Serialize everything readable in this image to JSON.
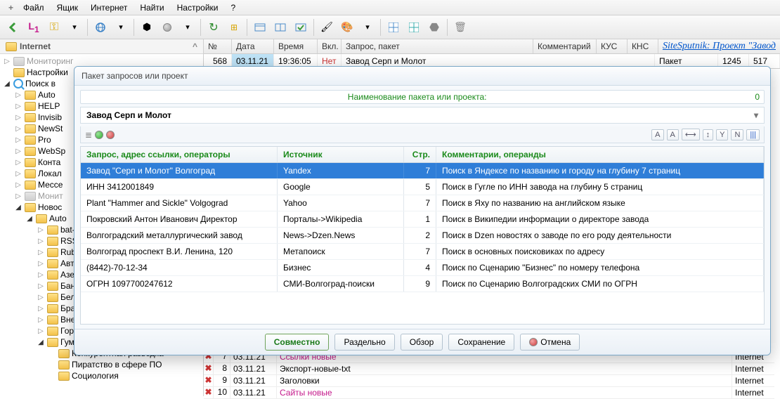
{
  "menu": {
    "plus": "+",
    "items": [
      "Файл",
      "Ящик",
      "Интернет",
      "Найти",
      "Настройки",
      "?"
    ]
  },
  "toolbar_icons": [
    "back-arrow",
    "l1",
    "keys",
    "v",
    "globe",
    "v",
    "cubes",
    "sphere",
    "v",
    "refresh",
    "tree-icon",
    "window",
    "window-h",
    "window-check",
    "brush",
    "palette",
    "v",
    "grid-blue",
    "grid-teal",
    "hexagon",
    "trash"
  ],
  "tree": {
    "header": "Internet",
    "nodes": [
      {
        "arrow": "▷",
        "cls": "gray indent-0",
        "label": "Мониторинг"
      },
      {
        "arrow": "",
        "cls": "indent-0",
        "label": "Настройки"
      },
      {
        "arrow": "◢",
        "cls": "indent-0 open",
        "icon": "mag",
        "label": "Поиск в"
      },
      {
        "arrow": "▷",
        "cls": "indent-1",
        "label": "Auto"
      },
      {
        "arrow": "▷",
        "cls": "indent-1",
        "label": "HELP"
      },
      {
        "arrow": "▷",
        "cls": "indent-1",
        "label": "Invisib"
      },
      {
        "arrow": "▷",
        "cls": "indent-1",
        "label": "NewSt"
      },
      {
        "arrow": "▷",
        "cls": "indent-1",
        "label": "Pro"
      },
      {
        "arrow": "▷",
        "cls": "indent-1",
        "label": "WebSp"
      },
      {
        "arrow": "▷",
        "cls": "indent-1",
        "label": "Конта"
      },
      {
        "arrow": "▷",
        "cls": "indent-1",
        "label": "Локал"
      },
      {
        "arrow": "▷",
        "cls": "indent-1",
        "label": "Мессе"
      },
      {
        "arrow": "▷",
        "cls": "gray indent-1",
        "label": "Монит"
      },
      {
        "arrow": "◢",
        "cls": "indent-1 open",
        "label": "Новос"
      },
      {
        "arrow": "◢",
        "cls": "indent-2 open",
        "label": "Auto"
      },
      {
        "arrow": "▷",
        "cls": "indent-3",
        "label": "bat-"
      },
      {
        "arrow": "▷",
        "cls": "indent-3",
        "label": "RSS"
      },
      {
        "arrow": "▷",
        "cls": "indent-3",
        "label": "Rubi"
      },
      {
        "arrow": "▷",
        "cls": "indent-3",
        "label": "Авто"
      },
      {
        "arrow": "▷",
        "cls": "indent-3",
        "label": "Азер"
      },
      {
        "arrow": "▷",
        "cls": "indent-3",
        "label": "Банн"
      },
      {
        "arrow": "▷",
        "cls": "indent-3",
        "label": "Бело"
      },
      {
        "arrow": "▷",
        "cls": "indent-3",
        "label": "Бра"
      },
      {
        "arrow": "▷",
        "cls": "indent-3",
        "label": "Внеш"
      },
      {
        "arrow": "▷",
        "cls": "indent-3",
        "label": "Горо"
      },
      {
        "arrow": "◢",
        "cls": "indent-3 open",
        "label": "Гуманитарное"
      },
      {
        "arrow": "",
        "cls": "indent-3",
        "label": "Конкурентная разведка",
        "pad": "64px"
      },
      {
        "arrow": "",
        "cls": "indent-3",
        "label": "Пиратство в сфере ПО",
        "pad": "64px"
      },
      {
        "arrow": "",
        "cls": "indent-3",
        "label": "Социология",
        "pad": "64px"
      }
    ]
  },
  "top_grid": {
    "headers": [
      "№",
      "Дата",
      "Время",
      "Вкл.",
      "Запрос, пакет",
      "Комментарий",
      "КУС",
      "КНС"
    ],
    "row": {
      "no": "568",
      "date": "03.11.21",
      "time": "19:36:05",
      "enabled": "Нет",
      "query": "Завод Серп и Молот",
      "comment": "Пакет",
      "kus": "1245",
      "kns": "517"
    }
  },
  "brand": "SiteSputnik: Проект \"Завод",
  "bottom_grid": [
    {
      "n": "7",
      "d": "03.11.21",
      "t": "Ссылки новые",
      "cls": "magenta",
      "s": "Internet"
    },
    {
      "n": "8",
      "d": "03.11.21",
      "t": "Экспорт-новые-txt",
      "cls": "",
      "s": "Internet"
    },
    {
      "n": "9",
      "d": "03.11.21",
      "t": "Заголовки",
      "cls": "",
      "s": "Internet"
    },
    {
      "n": "10",
      "d": "03.11.21",
      "t": "Сайты новые",
      "cls": "magenta",
      "s": "Internet"
    }
  ],
  "modal": {
    "title": "Пакет запросов или проект",
    "name_label": "Наименование пакета или проекта:",
    "count": "0",
    "pkg_title": "Завод Серп и Молот",
    "fmt_buttons": [
      "A",
      "A",
      "⟷",
      "↕",
      "Y",
      "N",
      "|||"
    ],
    "columns": [
      "Запрос, адрес ссылки, операторы",
      "Источник",
      "Стр.",
      "Комментарии, операнды"
    ],
    "rows": [
      {
        "q": "Завод \"Серп и Молот\" Волгоград",
        "s": "Yandex",
        "p": "7",
        "c": "Поиск в Яндексе по названию и городу на глубину 7 страниц",
        "sel": true
      },
      {
        "q": "ИНН 3412001849",
        "s": "Google",
        "p": "5",
        "c": "Поиск в Гугле по ИНН завода на глубину 5 страниц"
      },
      {
        "q": "Plant \"Hammer and Sickle\" Volgograd",
        "s": "Yahoo",
        "p": "7",
        "c": "Поиск в Яху по названию на английском языке"
      },
      {
        "q": "Покровский Антон Иванович Директор",
        "s": "Порталы->Wikipedia",
        "p": "1",
        "c": "Поиск в Википедии информации о директоре завода"
      },
      {
        "q": "Волгоградский металлургический завод",
        "s": "News->Dzen.News",
        "p": "2",
        "c": "Поиск в  Dzen новостях о заводе по его роду деятельности"
      },
      {
        "q": "Волгоград проспект В.И. Ленина, 120",
        "s": "Метапоиск",
        "p": "7",
        "c": "Поиск в основных поисковиках по адресу"
      },
      {
        "q": "(8442)-70-12-34",
        "s": "Бизнес",
        "p": "4",
        "c": "Поиск по Сценарию \"Бизнес\" по номеру телефона"
      },
      {
        "q": "ОГРН 1097700247612",
        "s": "СМИ-Волгоград-поиски",
        "p": "9",
        "c": "Поиск по Сценарию Волгоградских СМИ по ОГРН"
      }
    ],
    "buttons": [
      "Совместно",
      "Раздельно",
      "Обзор",
      "Сохранение",
      "Отмена"
    ]
  }
}
